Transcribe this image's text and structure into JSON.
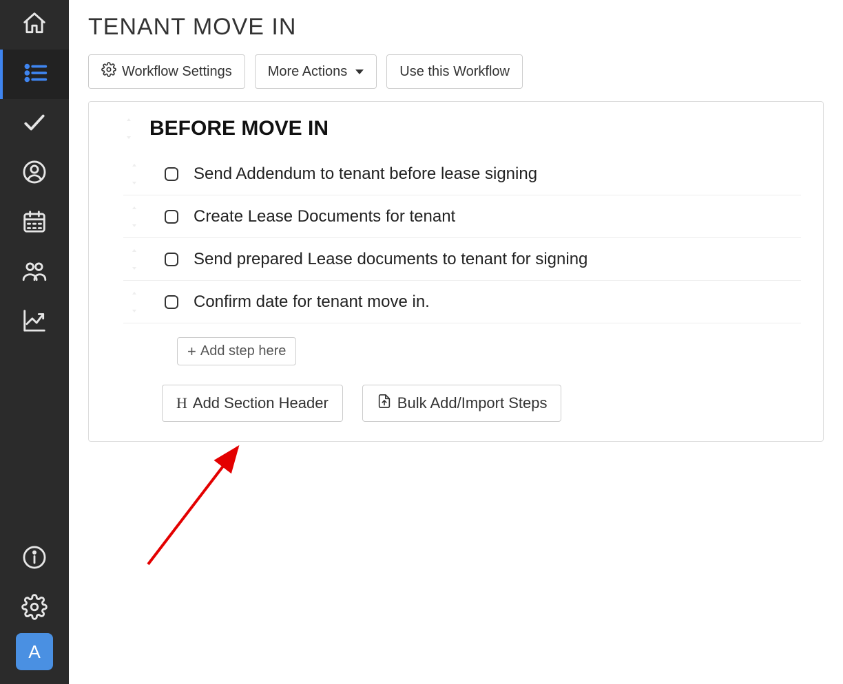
{
  "page": {
    "title": "TENANT MOVE IN"
  },
  "toolbar": {
    "workflow_settings_label": "Workflow Settings",
    "more_actions_label": "More Actions",
    "use_workflow_label": "Use this Workflow"
  },
  "section": {
    "title": "BEFORE MOVE IN",
    "steps": [
      {
        "label": "Send Addendum to tenant before lease signing"
      },
      {
        "label": "Create Lease Documents for tenant"
      },
      {
        "label": "Send prepared Lease documents to tenant for signing"
      },
      {
        "label": "Confirm date for tenant move in."
      }
    ],
    "add_step_label": "Add step here"
  },
  "footer": {
    "add_section_header_label": "Add Section Header",
    "bulk_import_label": "Bulk Add/Import Steps"
  },
  "avatar": {
    "letter": "A"
  },
  "icons": {
    "home": "home-icon",
    "list": "list-icon",
    "check": "check-icon",
    "user": "user-icon",
    "calendar": "calendar-icon",
    "group": "group-icon",
    "chart": "chart-icon",
    "info": "info-icon",
    "settings": "settings-icon"
  }
}
